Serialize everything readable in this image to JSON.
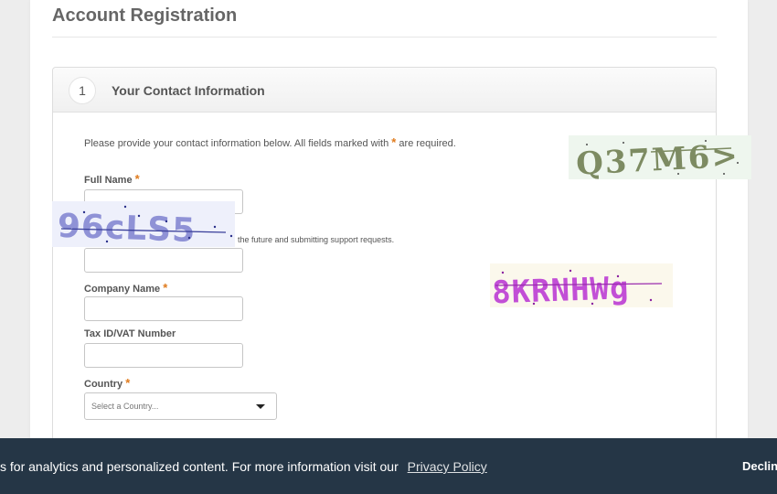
{
  "page": {
    "title": "Account Registration"
  },
  "section": {
    "number": "1",
    "title": "Your Contact Information"
  },
  "intro": {
    "before": "Please provide your contact information below. All fields marked with",
    "marker": "*",
    "after": "are required."
  },
  "fields": {
    "full_name": {
      "label": "Full Name",
      "required_marker": "*",
      "value": ""
    },
    "email": {
      "hint": "the future and submitting support requests.",
      "value": ""
    },
    "company_name": {
      "label": "Company Name",
      "required_marker": "*",
      "value": ""
    },
    "tax_id": {
      "label": "Tax ID/VAT Number",
      "value": ""
    },
    "country": {
      "label": "Country",
      "required_marker": "*",
      "placeholder": "Select a Country..."
    }
  },
  "captchas": [
    {
      "text": "Q37M6>",
      "color": "#7d8b62",
      "background": "#eef6ee"
    },
    {
      "text": "96cLS5",
      "color": "#8f92d6",
      "background": "#eef0fb"
    },
    {
      "text": "8KRNHWg",
      "color": "#c24fd6",
      "background": "#fbf8ec"
    }
  ],
  "cookie_banner": {
    "text": "s for analytics and personalized content. For more information visit our",
    "link": "Privacy Policy",
    "decline": "Decline"
  },
  "colors": {
    "required": "#e07b1d",
    "banner": "#253646"
  }
}
